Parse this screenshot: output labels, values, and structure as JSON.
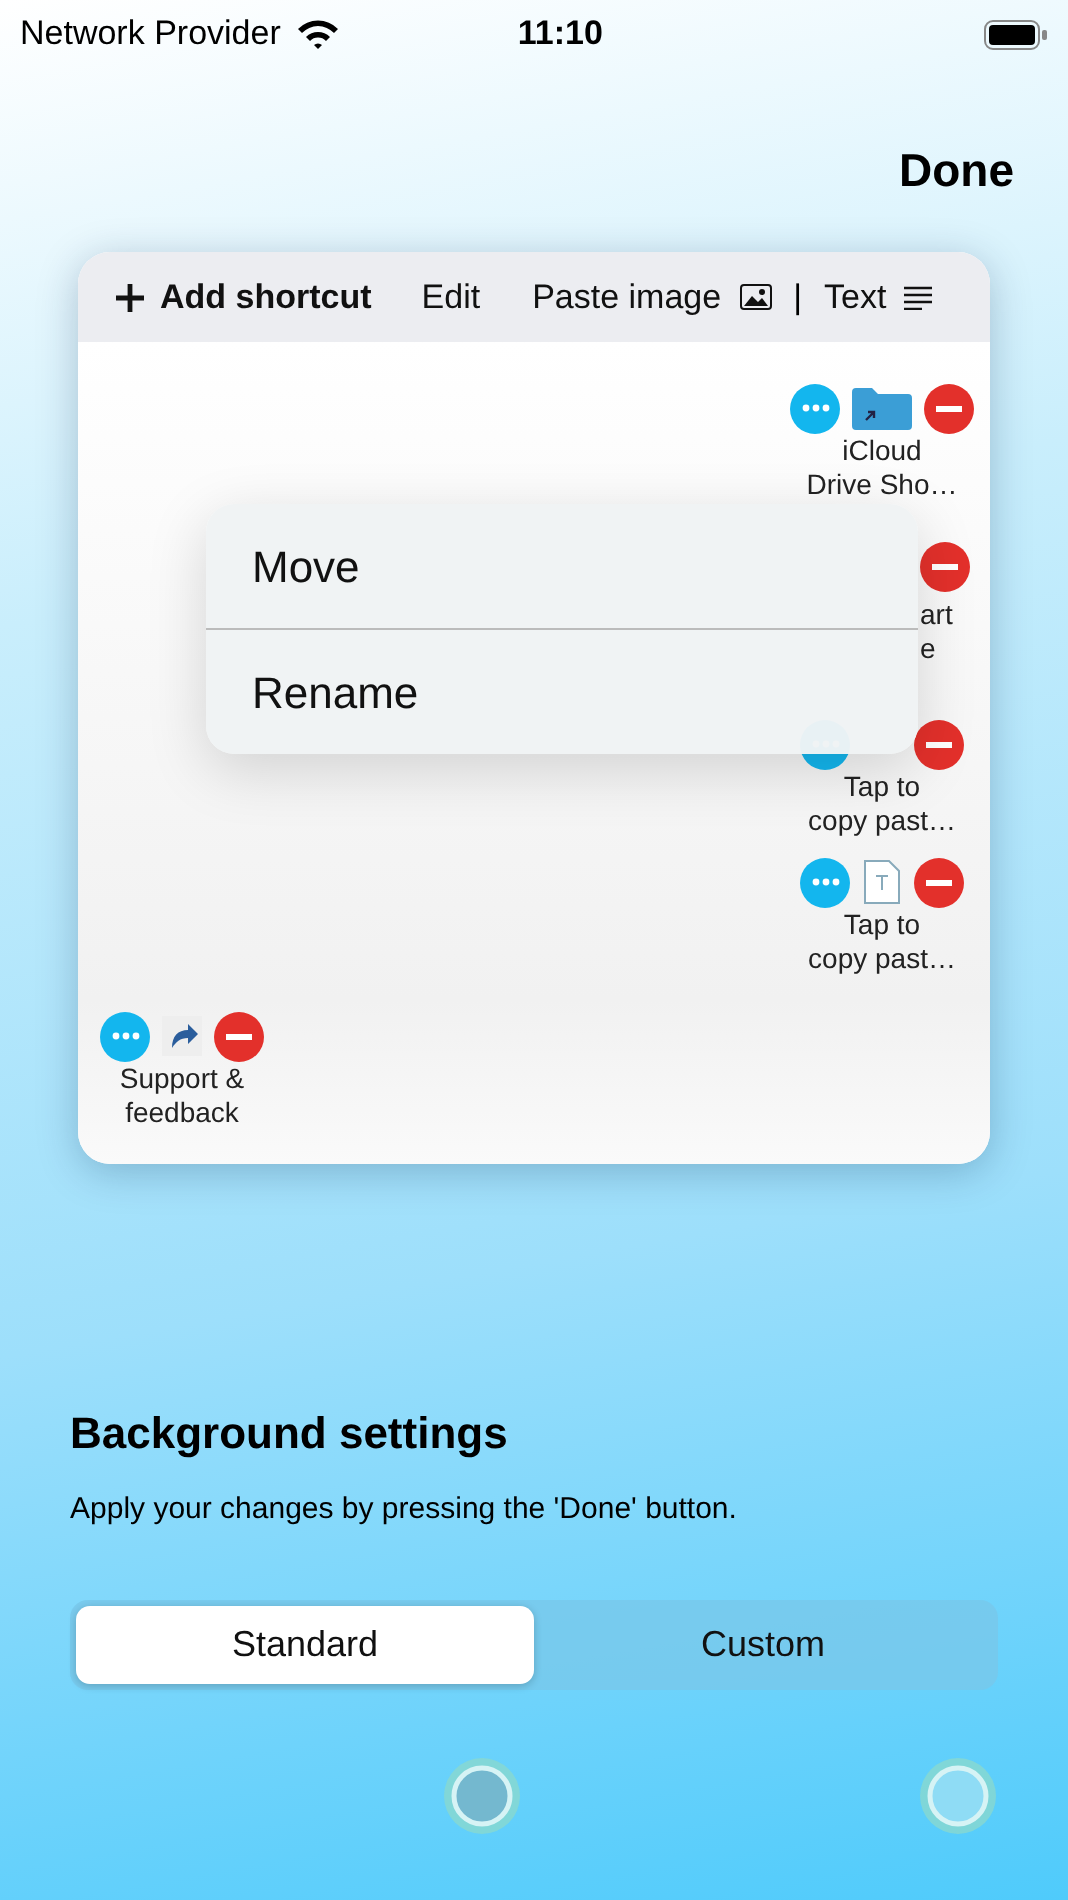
{
  "status_bar": {
    "carrier": "Network Provider",
    "time": "11:10"
  },
  "done_button": "Done",
  "toolbar": {
    "add": "Add shortcut",
    "edit": "Edit",
    "paste_image": "Paste image",
    "separator": "|",
    "text": "Text"
  },
  "shortcuts": [
    {
      "kind": "folder",
      "lines": [
        "iCloud",
        "Drive Sho…"
      ]
    },
    {
      "kind": "hidden",
      "lines": [
        "art",
        "e"
      ]
    },
    {
      "kind": "none",
      "lines": [
        "Tap to",
        "copy past…"
      ]
    },
    {
      "kind": "document",
      "lines": [
        "Tap to",
        "copy past…"
      ]
    },
    {
      "kind": "link",
      "lines": [
        "Support &",
        "feedback"
      ]
    }
  ],
  "context_menu": [
    "Move",
    "Rename"
  ],
  "background_settings": {
    "title": "Background settings",
    "description": "Apply your changes by pressing the 'Done' button.",
    "segments": [
      {
        "label": "Standard",
        "selected": true
      },
      {
        "label": "Custom",
        "selected": false
      }
    ]
  }
}
